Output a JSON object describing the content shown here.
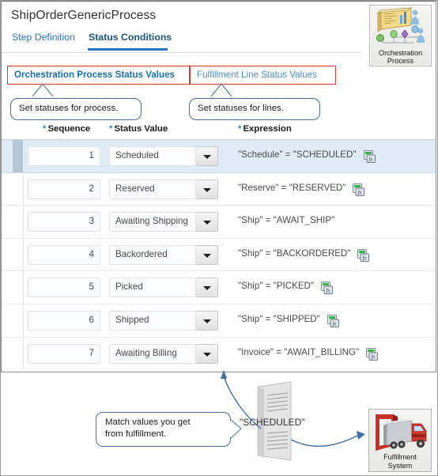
{
  "app": {
    "title": "ShipOrderGenericProcess",
    "tabs": [
      {
        "label": "Step Definition",
        "active": false
      },
      {
        "label": "Status Conditions",
        "active": true
      }
    ],
    "orchestration_icon": {
      "name": "orchestration-process-icon",
      "caption_line1": "Orchestration",
      "caption_line2": "Process"
    }
  },
  "subtabs": [
    {
      "label": "Orchestration Process Status Values",
      "active": true
    },
    {
      "label": "Fulfillment Line Status Values",
      "active": false
    }
  ],
  "annotations": {
    "process_callout": "Set statuses for  process.",
    "lines_callout": "Set statuses for  lines.",
    "match_callout_line1": "Match values  you get",
    "match_callout_line2": "from fulfillment.",
    "document_label": "\"SCHEDULED\""
  },
  "fulfillment_icon": {
    "name": "fulfillment-system-icon",
    "caption_line1": "Fulfillment",
    "caption_line2": "System"
  },
  "table": {
    "columns": [
      {
        "label": "Sequence",
        "required": true
      },
      {
        "label": "Status Value",
        "required": true
      },
      {
        "label": "Expression",
        "required": true
      }
    ],
    "required_marker": "*",
    "rows": [
      {
        "sequence": "1",
        "status": "Scheduled",
        "expression": "\"Schedule\" = \"SCHEDULED\"",
        "has_fx": true,
        "selected": true
      },
      {
        "sequence": "2",
        "status": "Reserved",
        "expression": "\"Reserve\" = \"RESERVED\"",
        "has_fx": true,
        "selected": false
      },
      {
        "sequence": "3",
        "status": "Awaiting Shipping",
        "expression": "\"Ship\" = \"AWAIT_SHIP\"",
        "has_fx": false,
        "selected": false
      },
      {
        "sequence": "4",
        "status": "Backordered",
        "expression": "\"Ship\" = \"BACKORDERED\"",
        "has_fx": true,
        "selected": false
      },
      {
        "sequence": "5",
        "status": "Picked",
        "expression": "\"Ship\" = \"PICKED\"",
        "has_fx": true,
        "selected": false
      },
      {
        "sequence": "6",
        "status": "Shipped",
        "expression": "\"Ship\" = \"SHIPPED\"",
        "has_fx": true,
        "selected": false
      },
      {
        "sequence": "7",
        "status": "Awaiting Billing",
        "expression": "\"Invoice\" = \"AWAIT_BILLING\"",
        "has_fx": true,
        "selected": false
      }
    ]
  },
  "colors": {
    "tab_active": "#19557f",
    "tab_link": "#2a74c4",
    "tab_underline": "#2a74c4",
    "redbox_border": "#d63b30",
    "subtab_active_text": "#1a6fb5",
    "subtab_inactive_text": "#4a90cf",
    "selected_row_bg": "#dfecf8",
    "selector_bar": "#b4c7d9",
    "callout_border": "#4a6f9c",
    "arrow": "#3f6fa5"
  }
}
